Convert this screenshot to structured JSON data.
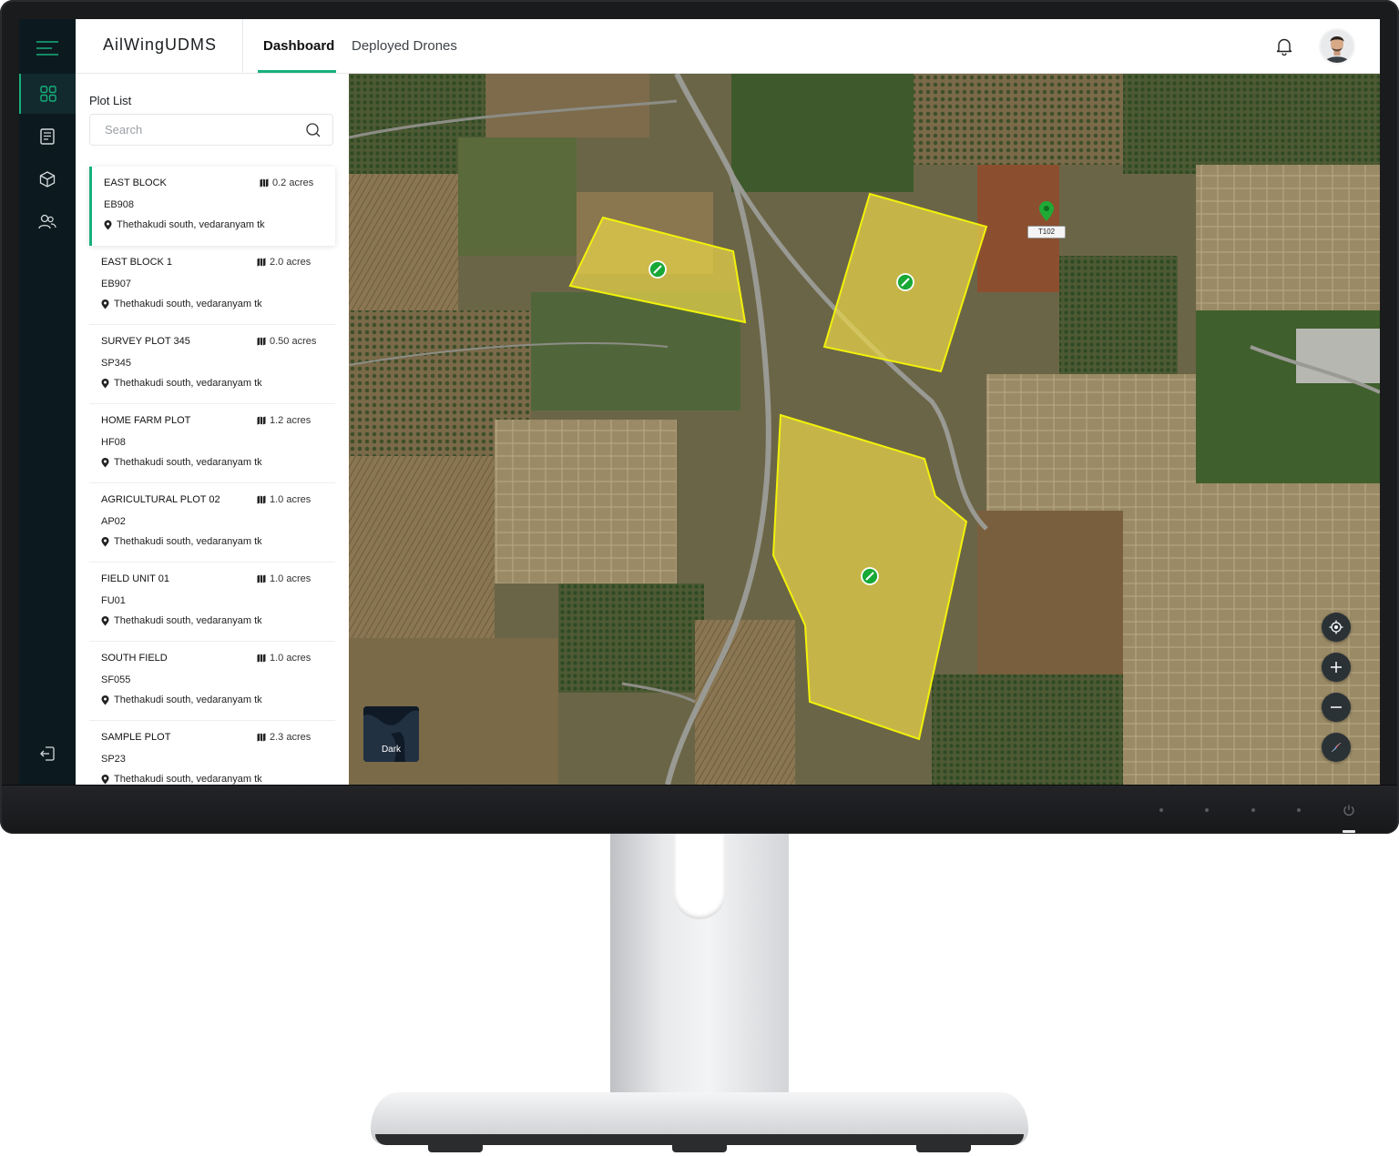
{
  "app": {
    "brand": "AilWingUDMS",
    "tabs": [
      {
        "label": "Dashboard",
        "active": true
      },
      {
        "label": "Deployed Drones",
        "active": false
      }
    ],
    "accent_color": "#17b07b"
  },
  "sidebar": {
    "icons": [
      "dashboard-grid-icon",
      "report-icon",
      "cube-icon",
      "users-icon",
      "logout-icon"
    ]
  },
  "panel": {
    "title": "Plot List",
    "search_placeholder": "Search",
    "plots": [
      {
        "name": "EAST BLOCK",
        "area": "0.2 acres",
        "code": "EB908",
        "location": "Thethakudi south, vedaranyam tk",
        "selected": true
      },
      {
        "name": "EAST BLOCK 1",
        "area": "2.0 acres",
        "code": "EB907",
        "location": "Thethakudi south, vedaranyam tk"
      },
      {
        "name": "SURVEY PLOT 345",
        "area": "0.50 acres",
        "code": "SP345",
        "location": "Thethakudi south, vedaranyam tk"
      },
      {
        "name": "HOME FARM PLOT",
        "area": "1.2 acres",
        "code": "HF08",
        "location": "Thethakudi south, vedaranyam tk"
      },
      {
        "name": "AGRICULTURAL PLOT 02",
        "area": "1.0 acres",
        "code": "AP02",
        "location": "Thethakudi south, vedaranyam tk"
      },
      {
        "name": "FIELD UNIT 01",
        "area": "1.0 acres",
        "code": "FU01",
        "location": "Thethakudi south, vedaranyam tk"
      },
      {
        "name": "SOUTH FIELD",
        "area": "1.0 acres",
        "code": "SF055",
        "location": "Thethakudi south, vedaranyam tk"
      },
      {
        "name": "SAMPLE PLOT",
        "area": "2.3 acres",
        "code": "SP23",
        "location": "Thethakudi south, vedaranyam tk"
      }
    ]
  },
  "map": {
    "marker_label": "T102",
    "layer_toggle": "Dark",
    "polygon_fill": "#e8d44a",
    "polygon_stroke": "#f2f20a",
    "controls": [
      "locate-icon",
      "zoom-in-icon",
      "zoom-out-icon",
      "compass-icon"
    ]
  }
}
